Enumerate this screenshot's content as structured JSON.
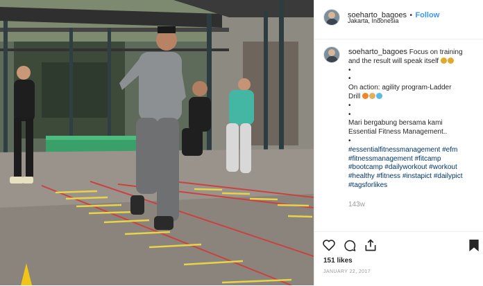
{
  "post": {
    "username": "soeharto_bagoes",
    "separator": "•",
    "follow_label": "Follow",
    "location": "Jakarta, Indonesia"
  },
  "caption": {
    "username": "soeharto_bagoes",
    "text_line1": " Focus on training",
    "text_line2": "and the result will speak itself ",
    "bullet1": "•",
    "bullet2": "•",
    "action_line1": "On action: agility program-Ladder",
    "action_line2": "Drill ",
    "bullet3": "•",
    "bullet4": "•",
    "join_line1": "Mari bergabung bersama kami",
    "join_line2": "Essential Fitness Management..",
    "bullet5": "•",
    "hashtags": [
      "#essentialfitnessmanagement #efm",
      "#fitnessmanagement #fitcamp",
      "#bootcamp #dailyworkout #workout",
      "#healthy #fitness #instapict #dailypict",
      "#tagsforlikes"
    ],
    "emoji_trophy": "trophy-icon",
    "emoji_fire": "fire-icon",
    "emoji_muscle": "muscle-icon",
    "emoji_sweat": "sweat-icon"
  },
  "meta": {
    "time_ago": "143w",
    "likes": "151 likes",
    "date": "JANUARY 22, 2017"
  },
  "icons": {
    "like": "heart-icon",
    "comment": "comment-icon",
    "share": "share-icon",
    "save": "bookmark-icon"
  },
  "colors": {
    "follow": "#3897f0",
    "hashtag": "#003569",
    "muted": "#999999",
    "text": "#262626"
  }
}
